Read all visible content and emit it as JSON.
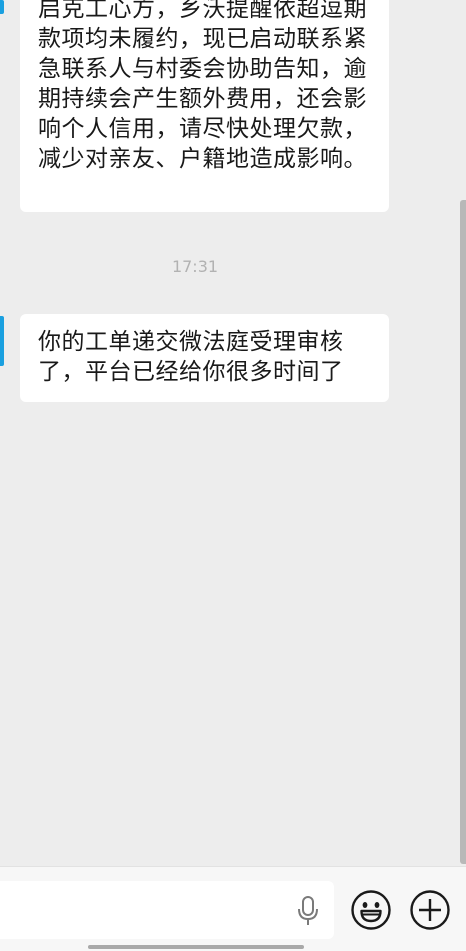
{
  "messages": [
    {
      "text": "启克工心方，乡沃提醒依超逗期款项均未履约，现已启动联系紧急联系人与村委会协助告知，逾期持续会产生额外费用，还会影响个人信用，请尽快处理欠款，减少对亲友、户籍地造成影响。"
    },
    {
      "text": "你的工单递交微法庭受理审核了，平台已经给你很多时间了"
    }
  ],
  "timestamp": "17:31",
  "input": {
    "placeholder": "",
    "value": ""
  },
  "icons": {
    "mic": "microphone-icon",
    "emoji": "smiley-icon",
    "add": "plus-circle-icon"
  },
  "colors": {
    "chat_background": "#ededed",
    "bubble_background": "#ffffff",
    "avatar_accent": "#1aa0e0",
    "timestamp_text": "#b2b2b2"
  }
}
